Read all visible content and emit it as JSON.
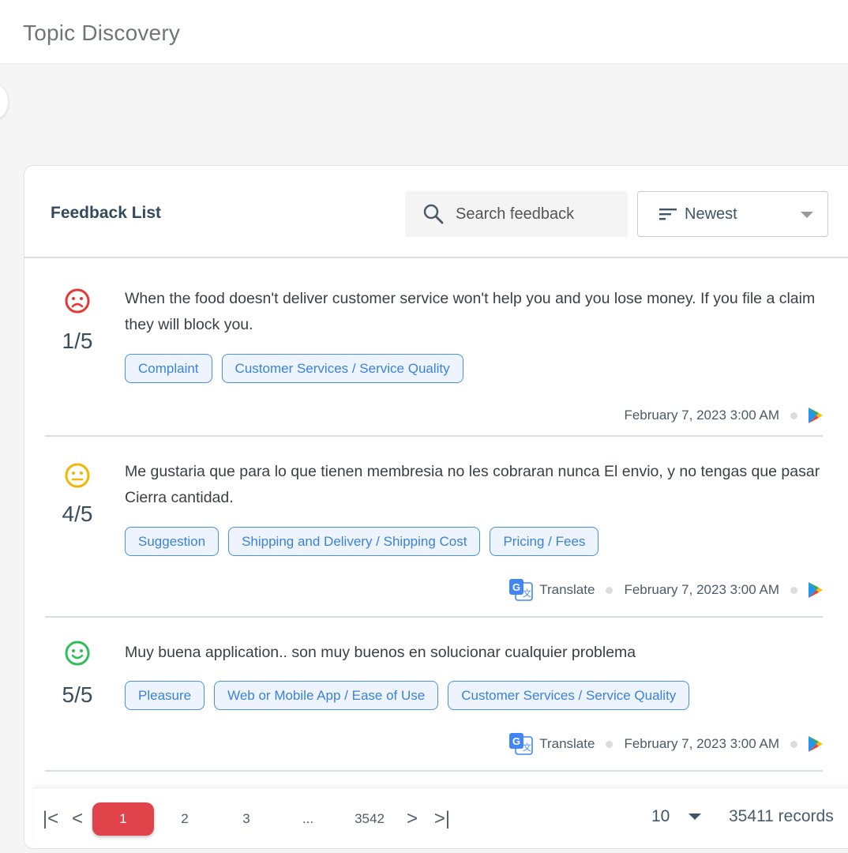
{
  "header": {
    "title": "Topic Discovery"
  },
  "feedback_list": {
    "title": "Feedback List",
    "search": {
      "placeholder": "Search feedback",
      "value": ""
    },
    "sort": {
      "selected": "Newest"
    },
    "items": [
      {
        "sentiment": "negative",
        "sentiment_color": "#e53935",
        "score": "1/5",
        "text": "When the food doesn't deliver customer service won't help you and you lose money. If you file a claim they will block you.",
        "tags": [
          "Complaint",
          "Customer Services / Service Quality"
        ],
        "translate": null,
        "date": "February 7, 2023 3:00 AM",
        "source_icon": "google-play-icon"
      },
      {
        "sentiment": "neutral",
        "sentiment_color": "#f2b705",
        "score": "4/5",
        "text": "Me gustaria que para lo que tienen membresia no les cobraran nunca El envio, y no tengas que pasar Cierra cantidad.",
        "tags": [
          "Suggestion",
          "Shipping and Delivery / Shipping Cost",
          "Pricing / Fees"
        ],
        "translate": "Translate",
        "date": "February 7, 2023 3:00 AM",
        "source_icon": "google-play-icon"
      },
      {
        "sentiment": "positive",
        "sentiment_color": "#2fbf5a",
        "score": "5/5",
        "text": "Muy buena application.. son muy buenos en solucionar cualquier problema",
        "tags": [
          "Pleasure",
          "Web or Mobile App / Ease of Use",
          "Customer Services / Service Quality"
        ],
        "translate": "Translate",
        "date": "February 7, 2023 3:00 AM",
        "source_icon": "google-play-icon"
      }
    ]
  },
  "pagination": {
    "pages": [
      "1",
      "2",
      "3",
      "...",
      "3542"
    ],
    "current": "1",
    "per_page": "10",
    "records": "35411 records"
  },
  "colors": {
    "accent": "#e0434a",
    "tag_border": "#4a8fe0",
    "tag_text": "#3a82d8"
  }
}
